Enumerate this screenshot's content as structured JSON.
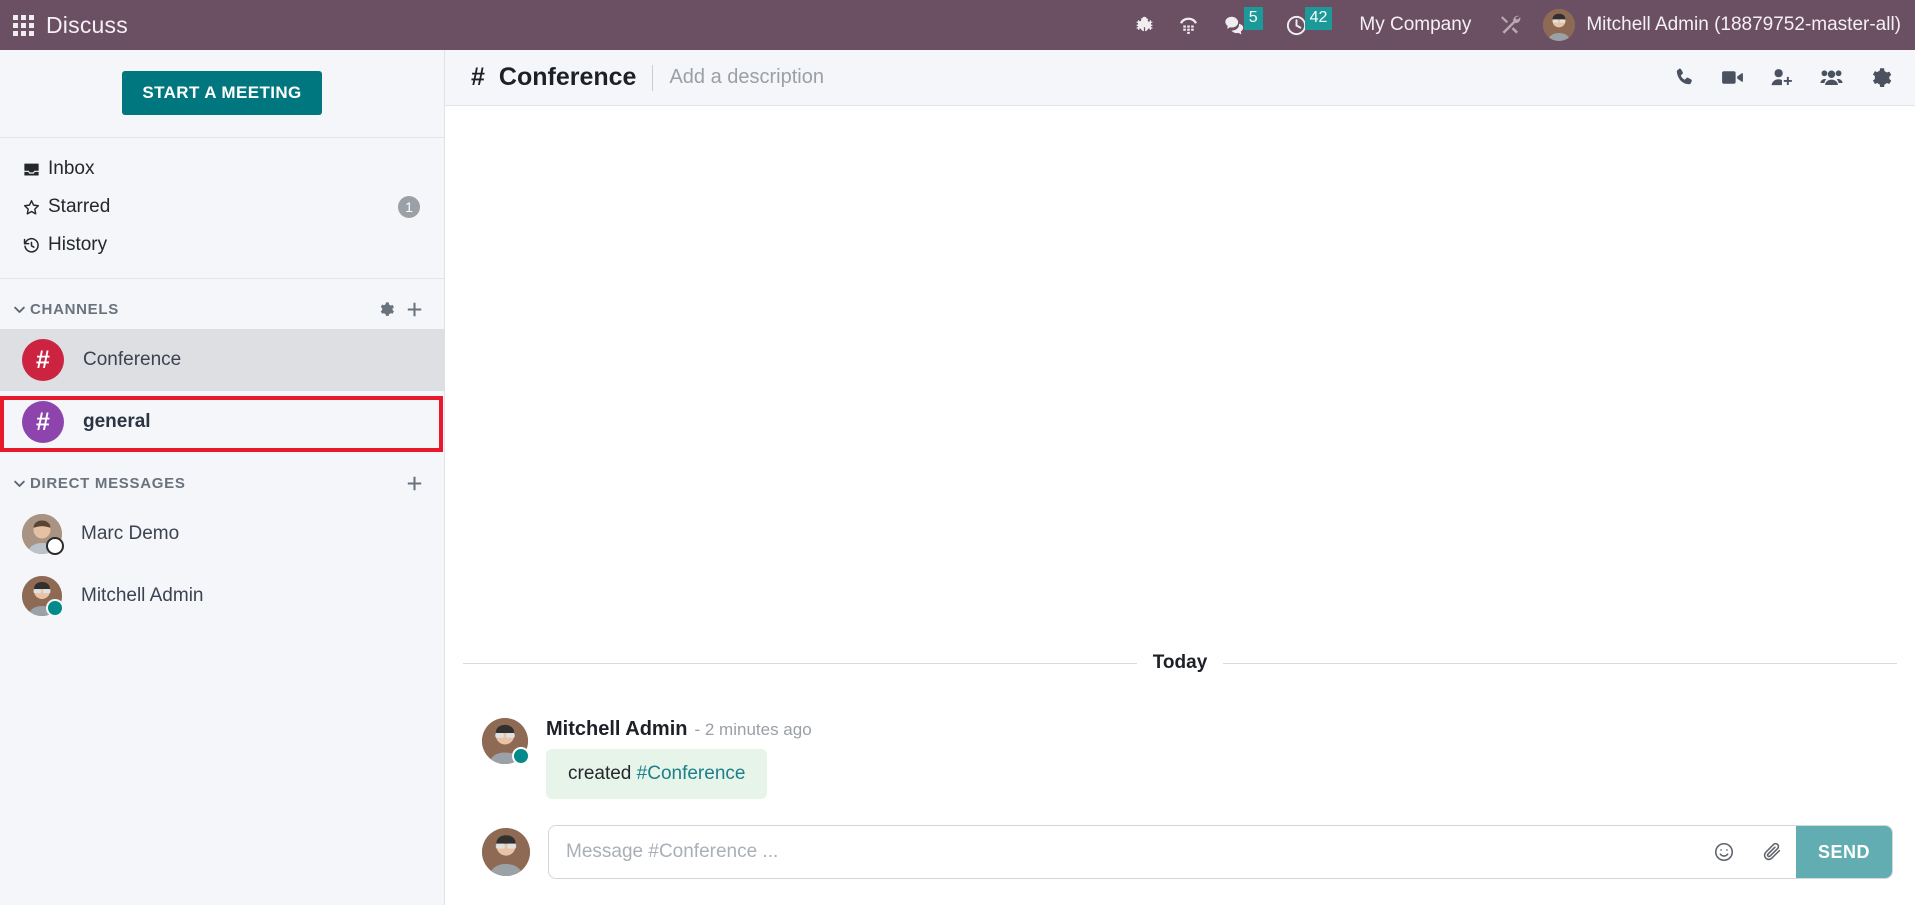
{
  "topbar": {
    "apps_icon": "apps-grid-icon",
    "app_title": "Discuss",
    "icons": [
      {
        "name": "bug-icon",
        "label": ""
      },
      {
        "name": "phone-dialpad-icon",
        "label": ""
      }
    ],
    "messages_badge": "5",
    "activities_badge": "42",
    "company": "My Company",
    "tools_icon": "tools-icon",
    "user_name": "Mitchell Admin (18879752-master-all)",
    "bg_color": "#6b4f63",
    "badge_color": "#1c9a9a"
  },
  "sidebar": {
    "start_meeting_label": "START A MEETING",
    "start_meeting_color": "#00767f",
    "mailboxes": [
      {
        "icon": "inbox-icon",
        "label": "Inbox",
        "badge": ""
      },
      {
        "icon": "star-icon",
        "label": "Starred",
        "badge": "1"
      },
      {
        "icon": "history-icon",
        "label": "History",
        "badge": ""
      }
    ],
    "channels_group": {
      "title": "CHANNELS",
      "settings_icon": "gear-icon",
      "add_icon": "plus-icon",
      "items": [
        {
          "name": "Conference",
          "color": "#cc2340",
          "active": true,
          "bold": false
        },
        {
          "name": "general",
          "color": "#8e44ad",
          "active": false,
          "bold": true
        }
      ]
    },
    "dm_group": {
      "title": "DIRECT MESSAGES",
      "add_icon": "plus-icon",
      "items": [
        {
          "name": "Marc Demo",
          "status": "offline"
        },
        {
          "name": "Mitchell Admin",
          "status": "online"
        }
      ]
    },
    "annotation_color": "#e8192c"
  },
  "channel_header": {
    "hash": "#",
    "title": "Conference",
    "description_placeholder": "Add a description",
    "actions": [
      {
        "name": "call-icon"
      },
      {
        "name": "video-camera-icon"
      },
      {
        "name": "add-user-icon"
      },
      {
        "name": "members-icon"
      },
      {
        "name": "settings-gear-icon"
      }
    ]
  },
  "thread": {
    "day_separator": "Today",
    "messages": [
      {
        "author": "Mitchell Admin",
        "time": "- 2 minutes ago",
        "text_prefix": "created ",
        "link": "#Conference",
        "status": "online",
        "bubble_color": "#e7f4e9"
      }
    ]
  },
  "composer": {
    "placeholder": "Message #Conference ...",
    "value": "",
    "emoji_icon": "smiley-icon",
    "attach_icon": "paperclip-icon",
    "send_label": "SEND",
    "send_color": "#62adb1"
  }
}
